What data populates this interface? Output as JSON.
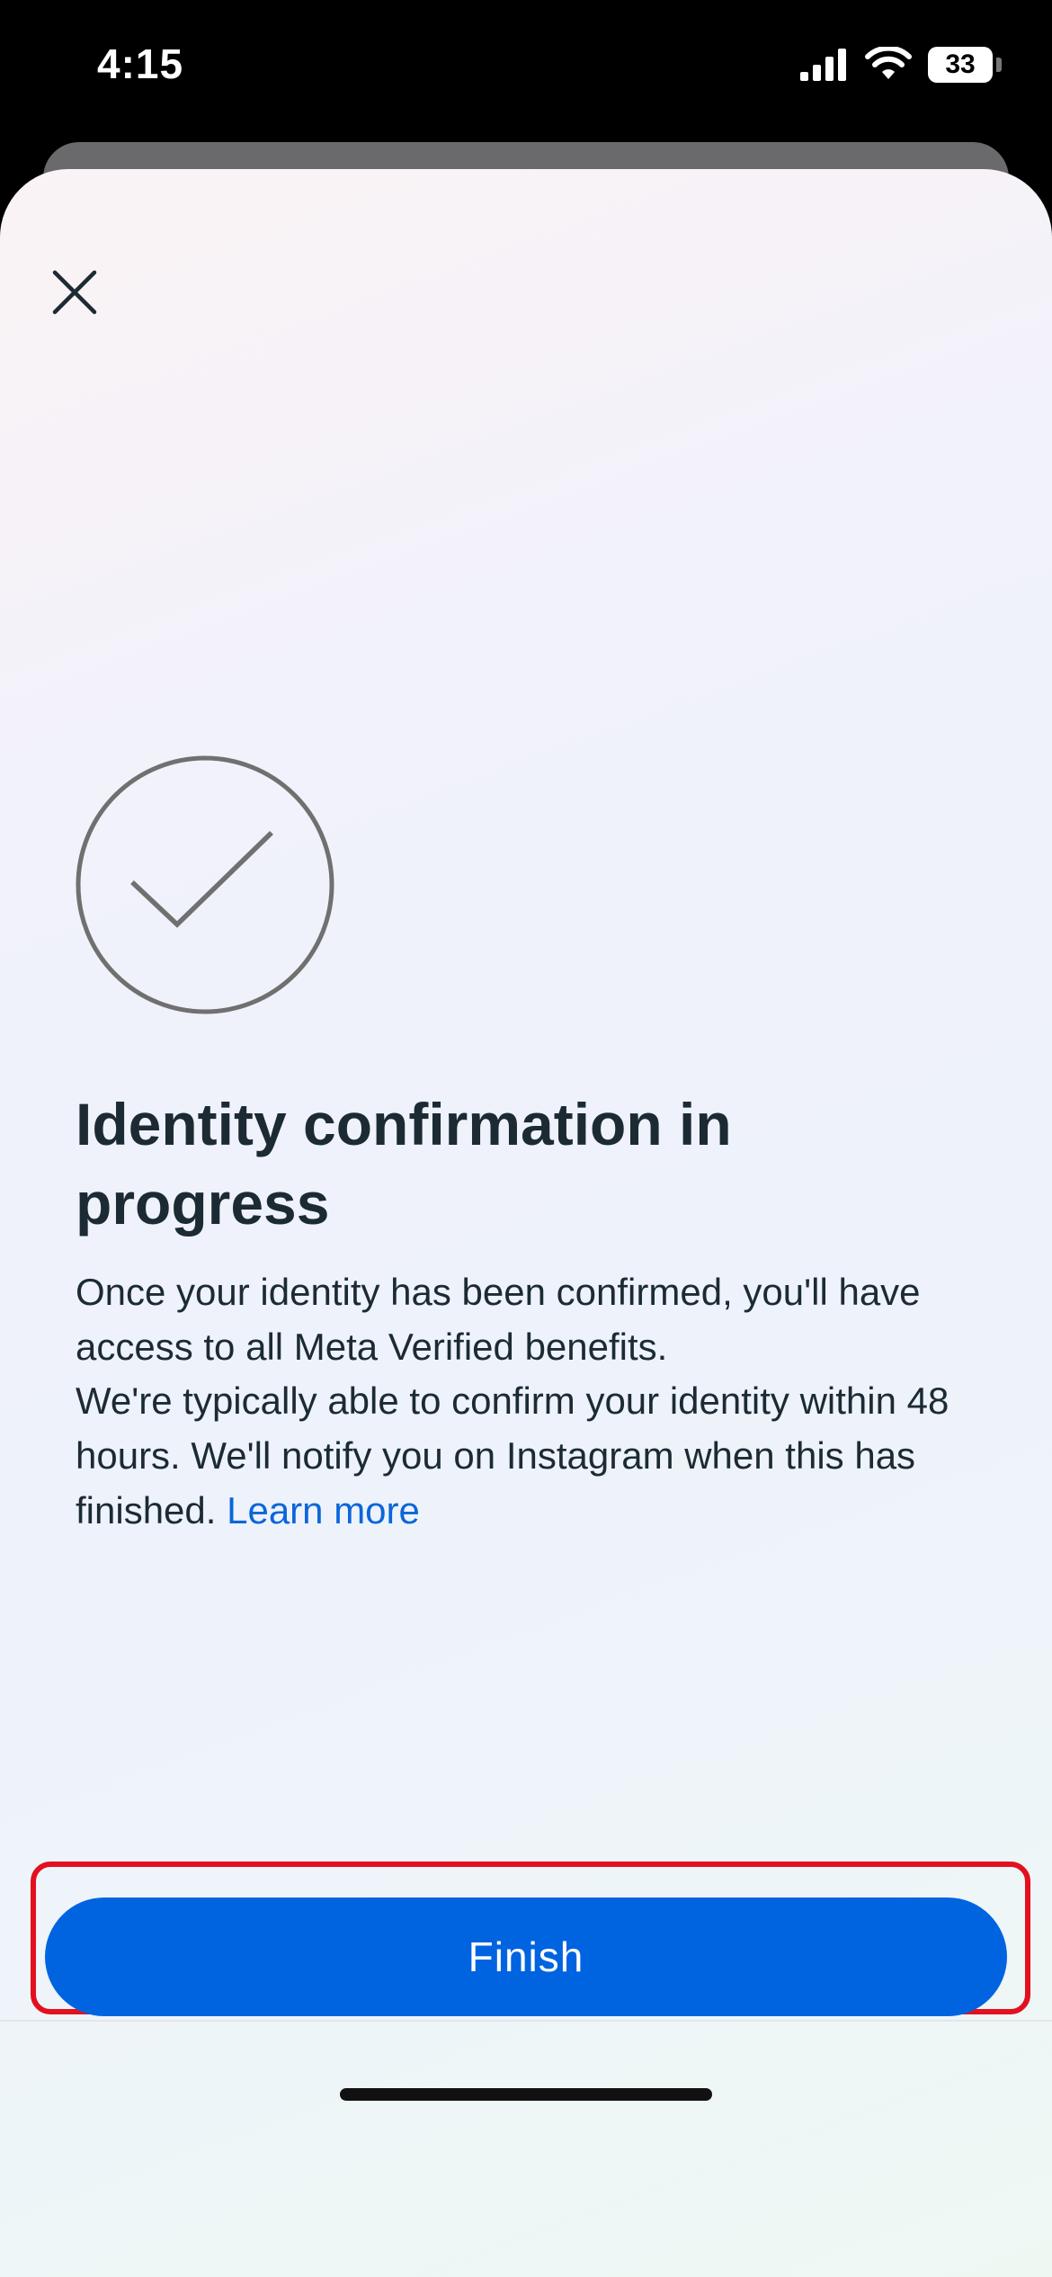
{
  "status_bar": {
    "time": "4:15",
    "battery_level": "33",
    "icons": [
      "signal-icon",
      "wifi-icon",
      "battery-icon"
    ]
  },
  "sheet": {
    "close_icon": "close-icon",
    "status_icon": "check-circle-icon",
    "title": "Identity confirmation in progress",
    "paragraph_1": "Once your identity has been confirmed, you'll have access to all Meta Verified benefits.",
    "paragraph_2": "We're typically able to confirm your identity within 48 hours. We'll notify you on Instagram when this has finished.",
    "learn_more_label": "Learn more"
  },
  "footer": {
    "finish_label": "Finish"
  },
  "colors": {
    "primary_button": "#0064e0",
    "link": "#0a66d9",
    "text": "#1c2b33",
    "highlight": "#e3101f"
  }
}
